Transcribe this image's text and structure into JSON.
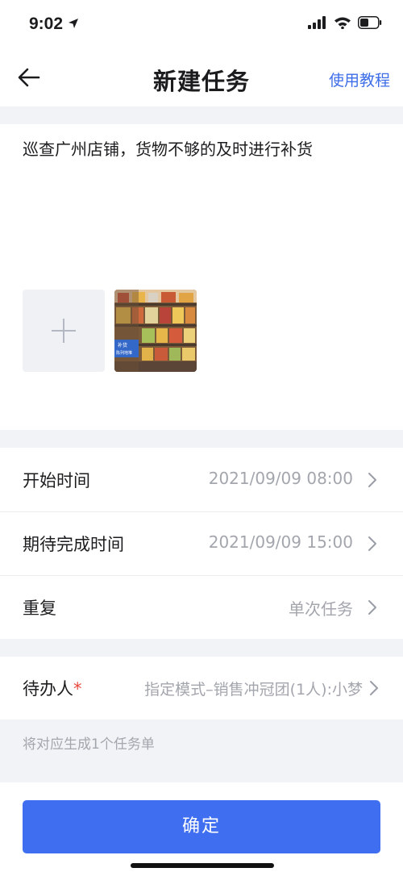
{
  "status_bar": {
    "time": "9:02"
  },
  "nav": {
    "title": "新建任务",
    "tutorial_label": "使用教程"
  },
  "task": {
    "description": "巡查广州店铺，货物不够的及时进行补货"
  },
  "photo": {
    "badge_line1": "补货",
    "badge_line2": "陈列地堆"
  },
  "form": {
    "start_time": {
      "label": "开始时间",
      "value": "2021/09/09 08:00"
    },
    "expected_finish": {
      "label": "期待完成时间",
      "value": "2021/09/09 15:00"
    },
    "repeat": {
      "label": "重复",
      "value": "单次任务"
    }
  },
  "assignee": {
    "label": "待办人",
    "required_mark": "*",
    "value": "指定模式–销售冲冠团(1人):小梦"
  },
  "hint": "将对应生成1个任务单",
  "confirm_label": "确定",
  "colors": {
    "accent": "#3f6ff0",
    "link": "#3d6ee8",
    "required": "#e8483c"
  }
}
